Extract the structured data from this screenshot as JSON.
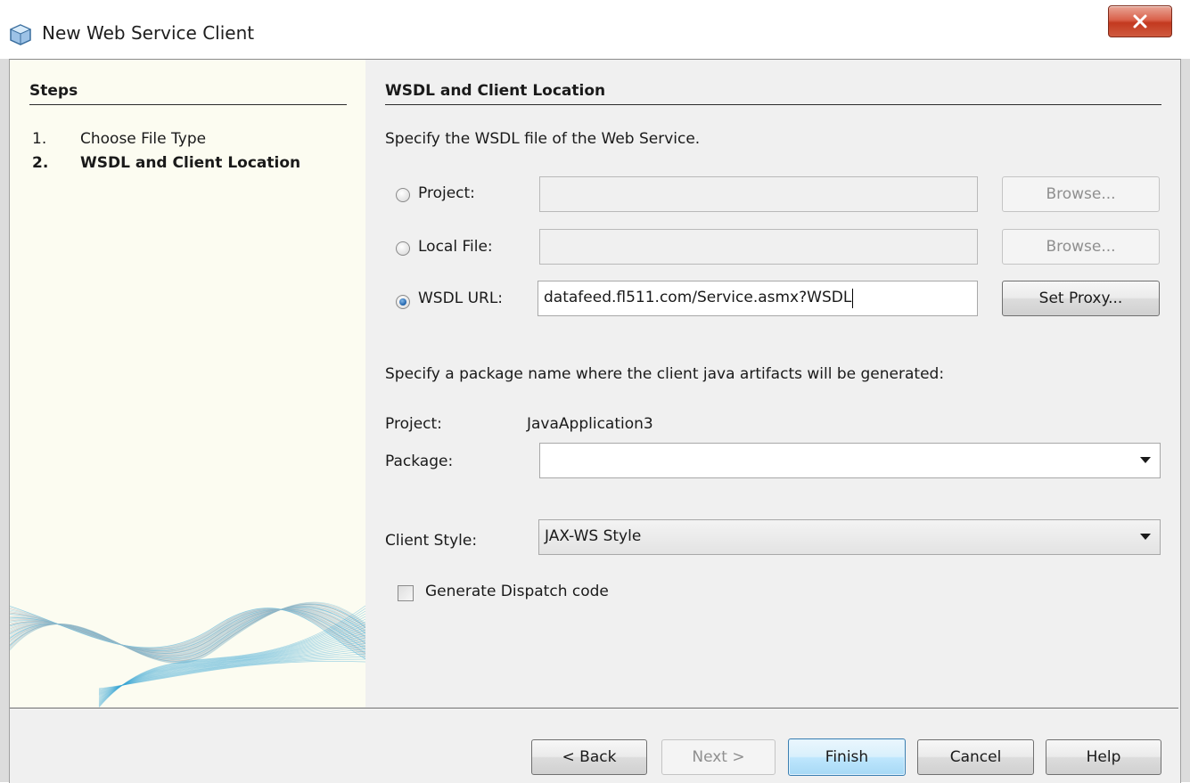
{
  "window": {
    "title": "New Web Service Client",
    "icon": "cube-icon",
    "close_icon": "close-icon"
  },
  "steps": {
    "heading": "Steps",
    "items": [
      {
        "number": "1.",
        "label": "Choose File Type",
        "current": false
      },
      {
        "number": "2.",
        "label": "WSDL and Client Location",
        "current": true
      }
    ]
  },
  "section": {
    "heading": "WSDL and Client Location",
    "wsdl_prompt": "Specify the WSDL file of the Web Service.",
    "sources": [
      {
        "label": "Project:",
        "value": "",
        "selected": false,
        "button": "Browse...",
        "button_enabled": false
      },
      {
        "label": "Local File:",
        "value": "",
        "selected": false,
        "button": "Browse...",
        "button_enabled": false
      },
      {
        "label": "WSDL URL:",
        "value": "datafeed.fl511.com/Service.asmx?WSDL",
        "selected": true,
        "button": "Set Proxy...",
        "button_enabled": true
      }
    ],
    "package_prompt": "Specify a package name where the client java artifacts will be generated:",
    "project_label": "Project:",
    "project_value": "JavaApplication3",
    "package_label": "Package:",
    "package_value": "",
    "client_style_label": "Client Style:",
    "client_style_value": "JAX-WS Style",
    "dispatch_label": "Generate Dispatch code",
    "dispatch_checked": false
  },
  "footer": {
    "back": "< Back",
    "next": "Next >",
    "finish": "Finish",
    "cancel": "Cancel",
    "help": "Help"
  },
  "colors": {
    "steps_panel_bg": "#fcfcf1",
    "dialog_bg": "#f0f0f0",
    "default_button": "#bee6fd",
    "close_button": "#c3391f",
    "radio_selected": "#1d5fa8"
  }
}
